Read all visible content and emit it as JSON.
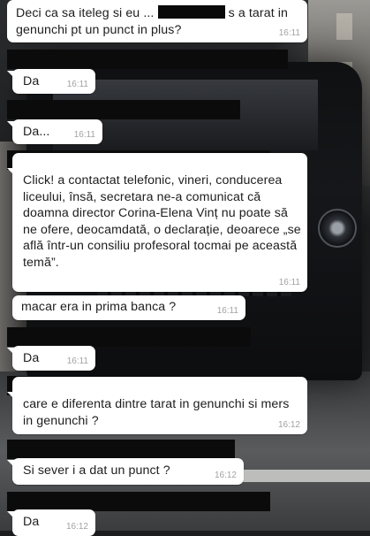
{
  "messages": [
    {
      "text_before": "Deci ca sa iteleg si eu ...",
      "text_after": "s a tarat in genunchi pt un punct in plus?",
      "time": "16:11"
    },
    {
      "text": "Da",
      "time": "16:11"
    },
    {
      "text": "Da...",
      "time": "16:11"
    },
    {
      "text": "Click! a contactat telefonic, vineri, conducerea liceului, însă, secretara ne-a comunicat că doamna director Corina-Elena Vinț nu poate să ne ofere, deocamdată, o declarație, deoarece „se află într-un consiliu profesoral tocmai pe această temă”.",
      "time": "16:11"
    },
    {
      "text": "macar era in prima banca ?",
      "time": "16:11"
    },
    {
      "text": "Da",
      "time": "16:11"
    },
    {
      "text": "care e diferenta dintre tarat in genunchi si mers in genunchi ?",
      "time": "16:12"
    },
    {
      "text": "Si sever i a dat un punct ?",
      "time": "16:12"
    },
    {
      "text": "Da",
      "time": "16:12"
    }
  ]
}
